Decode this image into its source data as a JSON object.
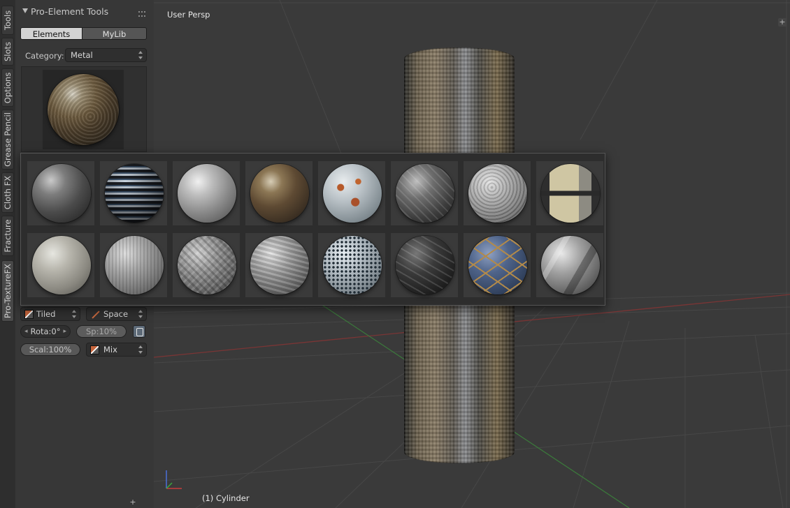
{
  "tabs": [
    "Tools",
    "Slots",
    "Options",
    "Grease Pencil",
    "Cloth FX",
    "Fracture",
    "Pro-TextureFX"
  ],
  "active_tab": "Pro-TextureFX",
  "panel": {
    "title": "Pro-Element Tools",
    "segments": {
      "elements": "Elements",
      "mylib": "MyLib"
    },
    "category_label": "Category:",
    "category_value": "Metal"
  },
  "controls": {
    "mapping": "Tiled",
    "space": "Space",
    "rotation": "Rota:0°",
    "spacing": "Sp:10%",
    "scale": "Scal:100%",
    "blend": "Mix"
  },
  "viewport": {
    "title": "User Persp",
    "status": "(1) Cylinder"
  },
  "materials": [
    "dark-scratched-metal",
    "ribbed-metal-stripes",
    "brushed-silver-metal",
    "rusty-stained-metal",
    "painted-rust-spots",
    "dark-diamond-plate",
    "hammered-metal",
    "banded-steel-panel",
    "worn-pale-metal",
    "vertical-brushed-metal",
    "diamond-tread-plate",
    "wavy-brushed-metal",
    "perforated-mesh",
    "black-woven-metal",
    "blue-riveted-plates",
    "crumpled-foil"
  ]
}
